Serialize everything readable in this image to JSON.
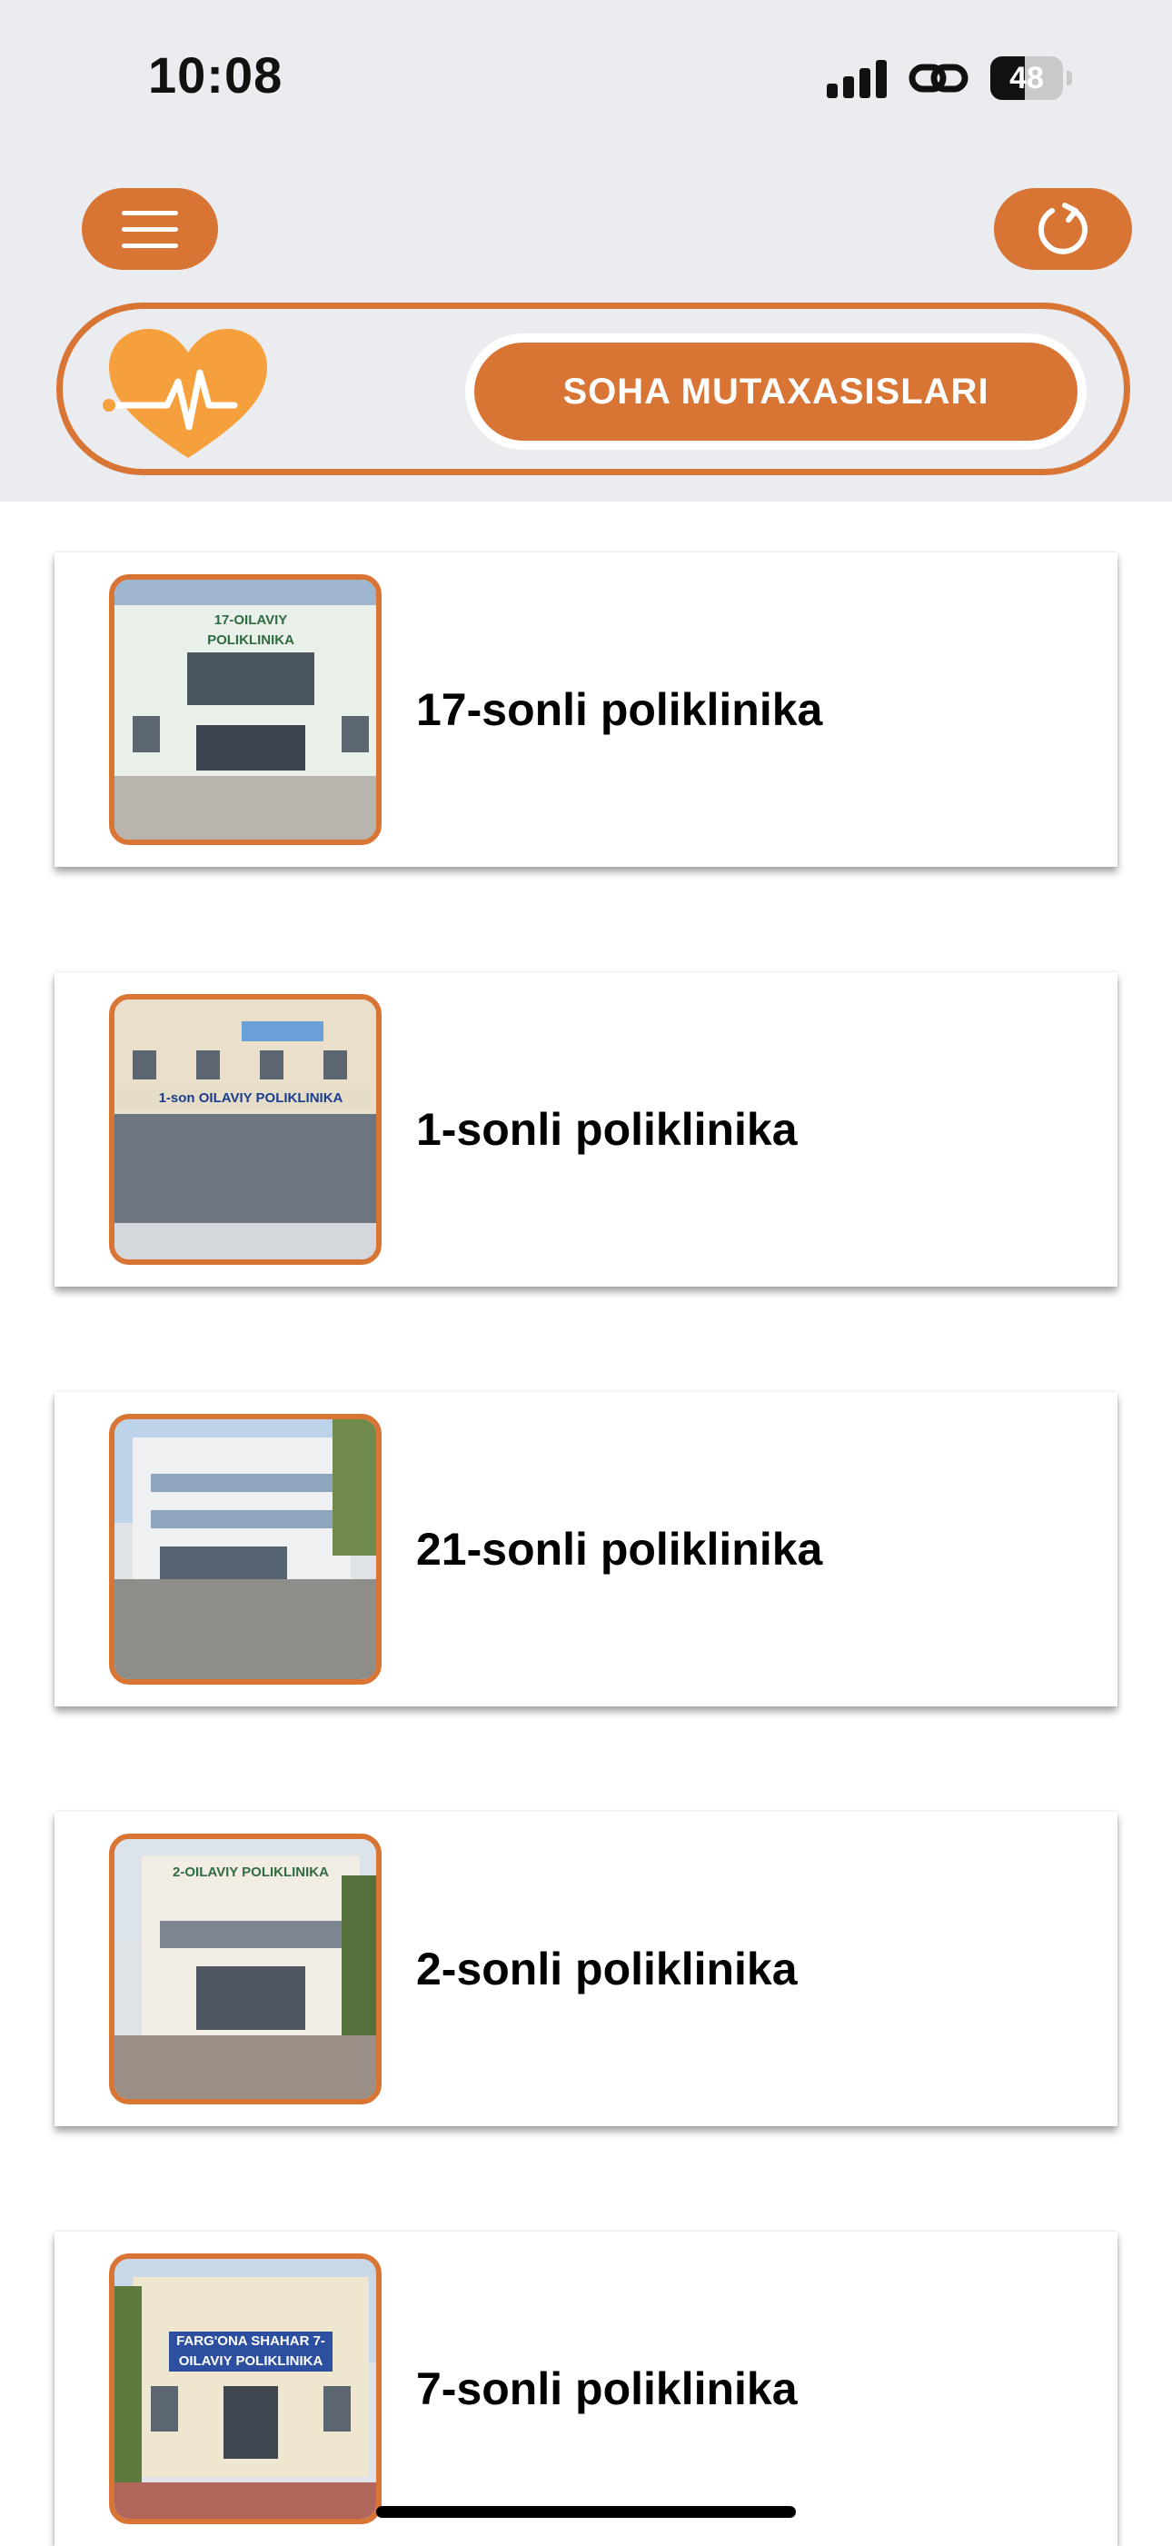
{
  "status_bar": {
    "time": "10:08",
    "battery": "48",
    "battery_level": 0.48
  },
  "header": {
    "menu_icon": "hamburger-menu-icon",
    "refresh_icon": "refresh-icon",
    "logo_icon": "heart-pulse-icon",
    "specialists_label": "SOHA MUTAXASISLARI"
  },
  "colors": {
    "accent": "#d87434",
    "header_bg": "#ebecf0",
    "heart": "#f5a03c"
  },
  "clinics": [
    {
      "name": "17-sonli poliklinika",
      "photo_sign": "17-OILAVIY POLIKLINIKA"
    },
    {
      "name": "1-sonli poliklinika",
      "photo_sign": "1-son OILAVIY POLIKLINIKA"
    },
    {
      "name": "21-sonli poliklinika",
      "photo_sign": ""
    },
    {
      "name": "2-sonli poliklinika",
      "photo_sign": "2-OILAVIY POLIKLINIKA"
    },
    {
      "name": "7-sonli poliklinika",
      "photo_sign": "FARG'ONA SHAHAR 7-OILAVIY POLIKLINIKA"
    }
  ]
}
